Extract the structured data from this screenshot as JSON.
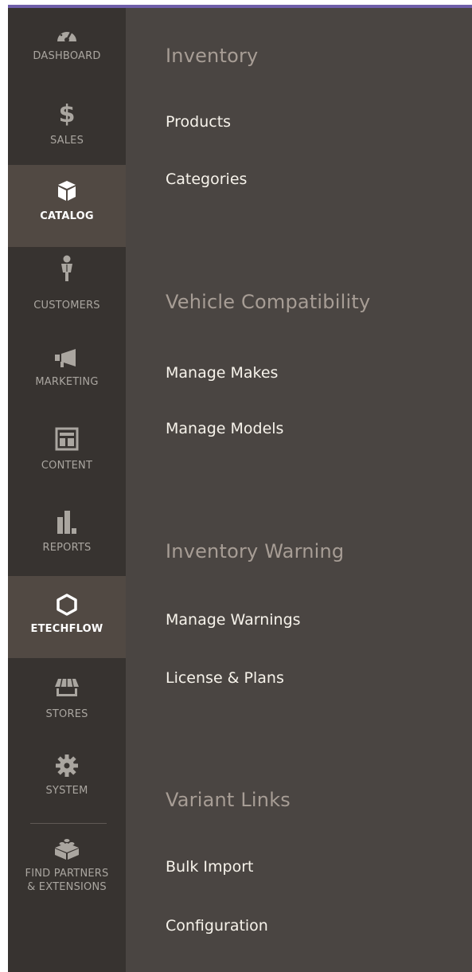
{
  "nav": {
    "items": [
      {
        "label": "DASHBOARD",
        "icon": "dashboard-icon"
      },
      {
        "label": "$",
        "icon": "dollar-icon"
      },
      {
        "label": "SALES"
      },
      {
        "label": "CATALOG",
        "icon": "box-icon"
      },
      {
        "label": "CUSTOMERS",
        "icon": "person-icon"
      },
      {
        "label": "MARKETING",
        "icon": "megaphone-icon"
      },
      {
        "label": "CONTENT",
        "icon": "layout-icon"
      },
      {
        "label": "REPORTS",
        "icon": "bar-chart-icon"
      },
      {
        "label": "ETECHFLOW",
        "icon": "hexagon-icon"
      },
      {
        "label": "STORES",
        "icon": "storefront-icon"
      },
      {
        "label": "SYSTEM",
        "icon": "gear-icon"
      },
      {
        "label_line1": "FIND PARTNERS",
        "label_line2": "& EXTENSIONS",
        "icon": "lego-brick-icon"
      }
    ],
    "active": "CATALOG"
  },
  "flyout": {
    "sections": [
      {
        "title": "Inventory",
        "links": [
          "Products",
          "Categories"
        ]
      },
      {
        "title": "Vehicle Compatibility",
        "links": [
          "Manage Makes",
          "Manage Models"
        ]
      },
      {
        "title": "Inventory Warning",
        "links": [
          "Manage Warnings",
          "License & Plans"
        ]
      },
      {
        "title": "Variant Links",
        "links": [
          "Bulk Import",
          "Configuration"
        ]
      }
    ]
  },
  "colors": {
    "accent": "#6f5ea9",
    "sidebar_bg": "#373330",
    "active_bg": "#514943",
    "flyout_bg": "#4a4542",
    "section_title": "#a79d95",
    "link_text": "#f7f3eb"
  }
}
